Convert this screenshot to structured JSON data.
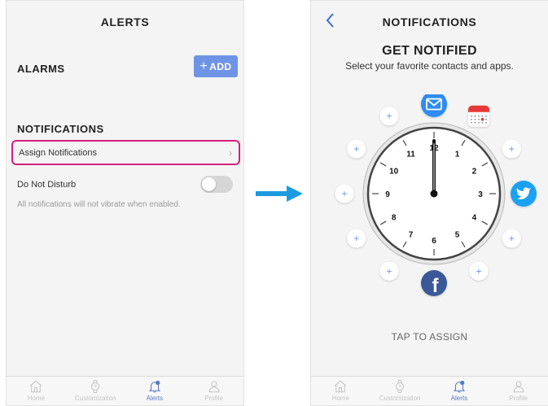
{
  "left": {
    "title": "ALERTS",
    "alarms_label": "ALARMS",
    "add_button": "ADD",
    "notifications_label": "NOTIFICATIONS",
    "assign_notifications": "Assign Notifications",
    "dnd_label": "Do Not Disturb",
    "dnd_enabled": false,
    "dnd_description": "All notifications will not vibrate when enabled."
  },
  "right": {
    "title": "NOTIFICATIONS",
    "headline": "GET NOTIFIED",
    "subline": "Select your favorite contacts and apps.",
    "tap_to_assign": "TAP TO ASSIGN",
    "clock_numbers": [
      "12",
      "1",
      "2",
      "3",
      "4",
      "5",
      "6",
      "7",
      "8",
      "9",
      "10",
      "11"
    ],
    "assigned_apps": [
      {
        "position": "12",
        "icon": "mail-icon",
        "color": "#2f8bf0"
      },
      {
        "position": "1",
        "icon": "calendar-icon",
        "color": "#e53935"
      },
      {
        "position": "3",
        "icon": "twitter-icon",
        "color": "#1da1f2"
      },
      {
        "position": "6",
        "icon": "facebook-icon",
        "color": "#3b5998"
      }
    ],
    "add_slots": [
      "11",
      "2",
      "10",
      "9",
      "8",
      "4",
      "7",
      "5"
    ]
  },
  "tabs": [
    {
      "label": "Home",
      "icon": "home-icon"
    },
    {
      "label": "Customization",
      "icon": "watch-icon"
    },
    {
      "label": "Alerts",
      "icon": "bell-icon",
      "active": true
    },
    {
      "label": "Profile",
      "icon": "person-icon"
    }
  ],
  "colors": {
    "accent": "#6f94e6",
    "highlight_border": "#d4207d",
    "arrow": "#1e9be0"
  }
}
